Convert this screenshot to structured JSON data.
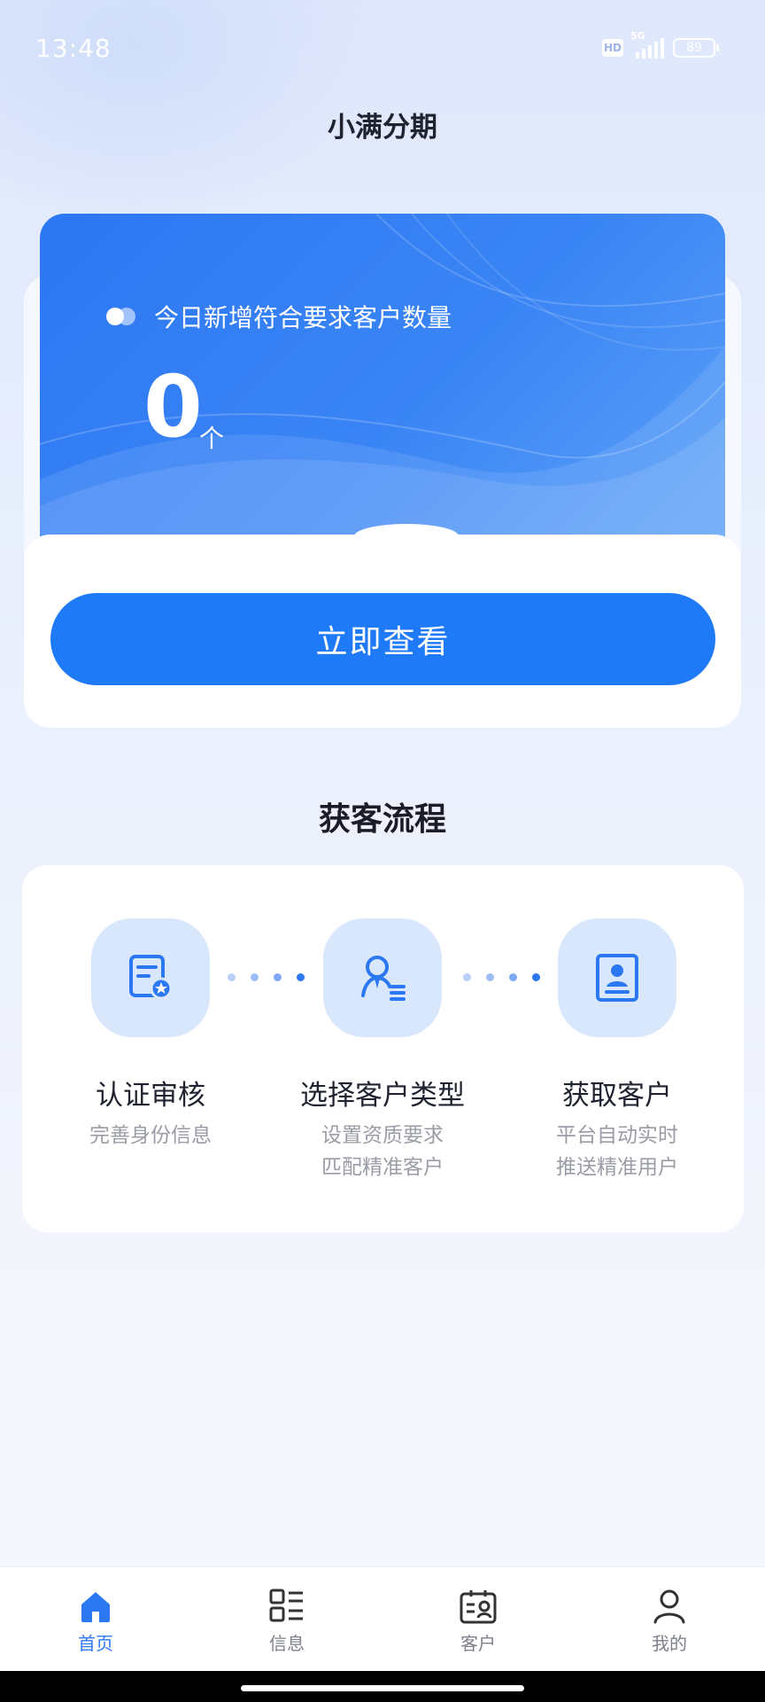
{
  "status": {
    "time": "13:48",
    "hd": "HD",
    "network": "5G",
    "battery": "89"
  },
  "app_title": "小满分期",
  "summary_card": {
    "label": "今日新增符合要求客户数量",
    "count": "0",
    "unit": "个",
    "button": "立即查看"
  },
  "process": {
    "title": "获客流程",
    "steps": [
      {
        "title": "认证审核",
        "desc": [
          "完善身份信息"
        ]
      },
      {
        "title": "选择客户类型",
        "desc": [
          "设置资质要求",
          "匹配精准客户"
        ]
      },
      {
        "title": "获取客户",
        "desc": [
          "平台自动实时",
          "推送精准用户"
        ]
      }
    ]
  },
  "colors": {
    "primary": "#1f7af8",
    "icon_bg": "#d9e7fd",
    "card_blue": "#3a85f5"
  },
  "nav": [
    {
      "label": "首页",
      "icon": "home-icon",
      "active": true
    },
    {
      "label": "信息",
      "icon": "list-icon",
      "active": false
    },
    {
      "label": "客户",
      "icon": "contact-card-icon",
      "active": false
    },
    {
      "label": "我的",
      "icon": "person-icon",
      "active": false
    }
  ]
}
